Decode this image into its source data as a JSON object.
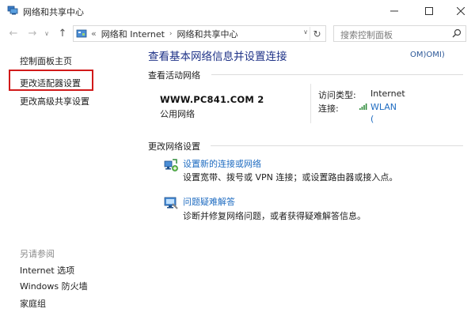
{
  "window": {
    "title": "网络和共享中心",
    "icon": "network-center-icon"
  },
  "nav": {
    "back_glyph": "←",
    "forward_glyph": "→",
    "history_glyph": "∨",
    "up_glyph": "↑"
  },
  "address": {
    "prefix": "«",
    "crumbs": [
      "网络和 Internet",
      "网络和共享中心"
    ],
    "separator": "›",
    "dropdown_glyph": "∨",
    "refresh_glyph": "↻"
  },
  "search": {
    "placeholder": "搜索控制面板"
  },
  "sidebar": {
    "items": [
      {
        "label": "控制面板主页"
      },
      {
        "label": "更改适配器设置",
        "highlighted": true
      },
      {
        "label": "更改高级共享设置"
      }
    ],
    "see_also_title": "另请参阅",
    "see_also": [
      {
        "label": "Internet 选项"
      },
      {
        "label": "Windows 防火墙"
      },
      {
        "label": "家庭组"
      }
    ],
    "highlight_color": "#d11a1a"
  },
  "main": {
    "title": "查看基本网络信息并设置连接",
    "user_tag": "OM)OMI)",
    "active_networks_label": "查看活动网络",
    "network": {
      "name": "WWW.PC841.COM  2",
      "type": "公用网络",
      "access_type_label": "访问类型:",
      "access_type_value": "Internet",
      "connections_label": "连接:",
      "connections_value": "WLAN",
      "connections_paren": "("
    },
    "change_settings_label": "更改网络设置",
    "tasks": [
      {
        "icon": "network-setup-icon",
        "link": "设置新的连接或网络",
        "desc": "设置宽带、拨号或 VPN 连接；或设置路由器或接入点。"
      },
      {
        "icon": "troubleshoot-icon",
        "link": "问题疑难解答",
        "desc": "诊断并修复网络问题，或者获得疑难解答信息。"
      }
    ]
  },
  "colors": {
    "link": "#1f6cc1",
    "title": "#1e3287"
  }
}
